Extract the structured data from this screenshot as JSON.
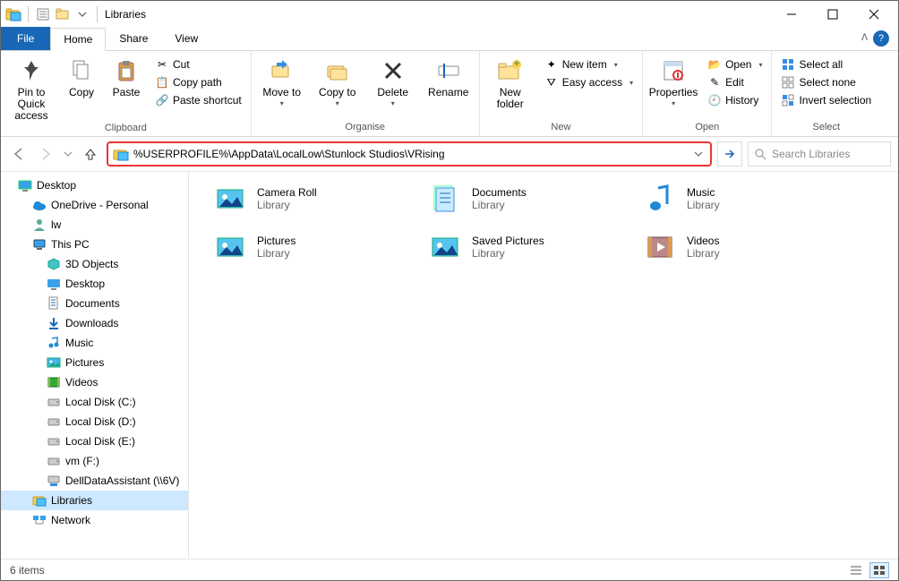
{
  "title": "Libraries",
  "menu": {
    "file": "File",
    "tabs": [
      "Home",
      "Share",
      "View"
    ],
    "active_tab": "Home"
  },
  "ribbon": {
    "clipboard": {
      "label": "Clipboard",
      "pin": "Pin to Quick access",
      "copy": "Copy",
      "paste": "Paste",
      "cut": "Cut",
      "copy_path": "Copy path",
      "paste_shortcut": "Paste shortcut"
    },
    "organise": {
      "label": "Organise",
      "move_to": "Move to",
      "copy_to": "Copy to",
      "delete": "Delete",
      "rename": "Rename"
    },
    "new": {
      "label": "New",
      "new_folder": "New folder",
      "new_item": "New item",
      "easy_access": "Easy access"
    },
    "open": {
      "label": "Open",
      "properties": "Properties",
      "open": "Open",
      "edit": "Edit",
      "history": "History"
    },
    "select": {
      "label": "Select",
      "select_all": "Select all",
      "select_none": "Select none",
      "invert": "Invert selection"
    }
  },
  "address": "%USERPROFILE%\\AppData\\LocalLow\\Stunlock Studios\\VRising",
  "search_placeholder": "Search Libraries",
  "tree": [
    {
      "label": "Desktop",
      "indent": 0,
      "icon": "desktop"
    },
    {
      "label": "OneDrive - Personal",
      "indent": 1,
      "icon": "onedrive"
    },
    {
      "label": "lw",
      "indent": 1,
      "icon": "user"
    },
    {
      "label": "This PC",
      "indent": 1,
      "icon": "pc"
    },
    {
      "label": "3D Objects",
      "indent": 2,
      "icon": "3d"
    },
    {
      "label": "Desktop",
      "indent": 2,
      "icon": "desktop2"
    },
    {
      "label": "Documents",
      "indent": 2,
      "icon": "doc"
    },
    {
      "label": "Downloads",
      "indent": 2,
      "icon": "dl"
    },
    {
      "label": "Music",
      "indent": 2,
      "icon": "music"
    },
    {
      "label": "Pictures",
      "indent": 2,
      "icon": "pic"
    },
    {
      "label": "Videos",
      "indent": 2,
      "icon": "vid"
    },
    {
      "label": "Local Disk (C:)",
      "indent": 2,
      "icon": "disk"
    },
    {
      "label": "Local Disk (D:)",
      "indent": 2,
      "icon": "disk"
    },
    {
      "label": "Local Disk (E:)",
      "indent": 2,
      "icon": "disk"
    },
    {
      "label": "vm (F:)",
      "indent": 2,
      "icon": "disk"
    },
    {
      "label": "DellDataAssistant (\\\\6V)",
      "indent": 2,
      "icon": "netdrive"
    },
    {
      "label": "Libraries",
      "indent": 1,
      "icon": "libraries",
      "selected": true
    },
    {
      "label": "Network",
      "indent": 1,
      "icon": "network"
    }
  ],
  "items": [
    {
      "name": "Camera Roll",
      "sub": "Library",
      "icon": "pic"
    },
    {
      "name": "Documents",
      "sub": "Library",
      "icon": "doc"
    },
    {
      "name": "Music",
      "sub": "Library",
      "icon": "music"
    },
    {
      "name": "Pictures",
      "sub": "Library",
      "icon": "pic"
    },
    {
      "name": "Saved Pictures",
      "sub": "Library",
      "icon": "pic"
    },
    {
      "name": "Videos",
      "sub": "Library",
      "icon": "vid"
    }
  ],
  "status": "6 items"
}
